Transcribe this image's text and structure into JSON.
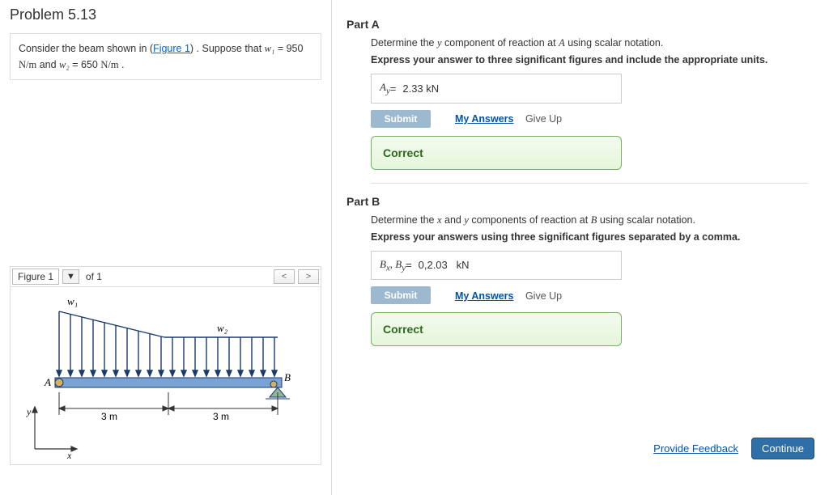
{
  "problem": {
    "title": "Problem 5.13",
    "intro_pre": "Consider the beam shown in (",
    "intro_link": "Figure 1",
    "intro_post": ") . Suppose that ",
    "w1_name": "w₁",
    "w1_eq": " = 950 ",
    "w1_unit": "N/m",
    "intro_and": " and ",
    "w2_name": "w₂",
    "w2_eq": " = 650 ",
    "w2_unit": "N/m",
    "intro_end": " ."
  },
  "figure": {
    "label": "Figure 1",
    "dd": "▼",
    "of": "of 1",
    "prev": "<",
    "next": ">",
    "labels": {
      "w1": "w₁",
      "w2": "w₂",
      "A": "A",
      "B": "B",
      "dim1": "3 m",
      "dim2": "3 m",
      "x": "x",
      "y": "y"
    }
  },
  "partA": {
    "title": "Part A",
    "prompt_pre": "Determine the ",
    "prompt_var": "y",
    "prompt_mid": " component of reaction at ",
    "prompt_pt": "A",
    "prompt_post": " using scalar notation.",
    "instruction": "Express your answer to three significant figures and include the appropriate units.",
    "var_label": "A",
    "var_sub": "y",
    "eq": " = ",
    "value": "2.33 kN",
    "submit": "Submit",
    "my_answers": "My Answers",
    "give_up": "Give Up",
    "feedback": "Correct"
  },
  "partB": {
    "title": "Part B",
    "prompt_pre": "Determine the ",
    "prompt_var1": "x",
    "prompt_and": " and ",
    "prompt_var2": "y",
    "prompt_mid": " components of reaction at ",
    "prompt_pt": "B",
    "prompt_post": " using scalar notation.",
    "instruction": "Express your answers using three significant figures separated by a comma.",
    "var_label": "B",
    "var_sub1": "x",
    "var_sep": ", ",
    "var_sub2": "y",
    "eq": " = ",
    "value": "0,2.03",
    "unit_spacer": "   ",
    "unit": "kN",
    "submit": "Submit",
    "my_answers": "My Answers",
    "give_up": "Give Up",
    "feedback": "Correct"
  },
  "footer": {
    "feedback": "Provide Feedback",
    "continue": "Continue"
  }
}
